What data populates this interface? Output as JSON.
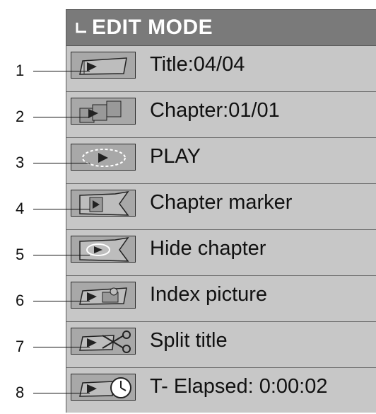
{
  "header": {
    "title": "EDIT MODE"
  },
  "items": [
    {
      "number": "1",
      "label": "Title:04/04",
      "icon": "title-folder-icon"
    },
    {
      "number": "2",
      "label": "Chapter:01/01",
      "icon": "chapter-grid-icon"
    },
    {
      "number": "3",
      "label": "PLAY",
      "icon": "play-loop-icon"
    },
    {
      "number": "4",
      "label": "Chapter marker",
      "icon": "chapter-marker-flag-icon"
    },
    {
      "number": "5",
      "label": "Hide chapter",
      "icon": "hide-chapter-flag-icon"
    },
    {
      "number": "6",
      "label": "Index picture",
      "icon": "index-picture-icon"
    },
    {
      "number": "7",
      "label": "Split title",
      "icon": "scissors-icon"
    },
    {
      "number": "8",
      "label": "T- Elapsed: 0:00:02",
      "icon": "clock-icon"
    }
  ]
}
